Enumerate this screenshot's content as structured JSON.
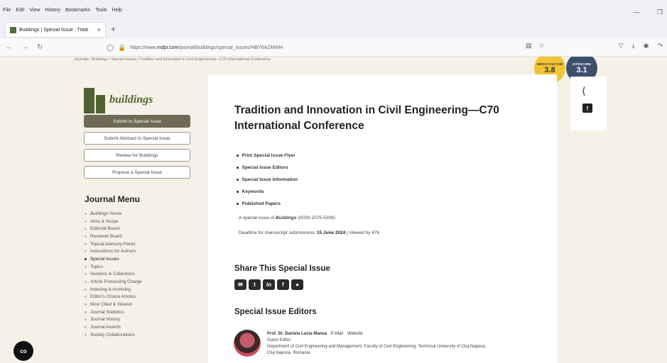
{
  "menubar": {
    "items": [
      "File",
      "Edit",
      "View",
      "History",
      "Bookmarks",
      "Tools",
      "Help"
    ]
  },
  "tab": {
    "title": "Buildings | Special Issue : Tradi",
    "close": "×",
    "new_tab": "+"
  },
  "navbar": {
    "url_prefix": "https://www.",
    "url_domain": "mdpi.com",
    "url_path": "/journal/buildings/special_issues/HBY6AZMWH"
  },
  "breadcrumb": "Journals / Buildings / Special Issues / Tradition and Innovation in Civil Engineering—C70 International Conference",
  "badges": {
    "impact_factor": {
      "label": "IMPACT FACTOR",
      "value": "3.8"
    },
    "citescore": {
      "label": "CITESCORE",
      "value": "3.1"
    }
  },
  "sidebar": {
    "journal_name": "buildings",
    "buttons": [
      "Submit to Special Issue",
      "Submit Abstract to Special Issue",
      "Review for Buildings",
      "Propose a Special Issue"
    ],
    "menu_title": "Journal Menu",
    "menu_home_italic": "Buildings",
    "menu_home_suffix": " Home",
    "menu_items": [
      "Aims & Scope",
      "Editorial Board",
      "Reviewer Board",
      "Topical Advisory Panel",
      "Instructions for Authors",
      "Special Issues",
      "Topics",
      "Sections & Collections",
      "Article Processing Charge",
      "Indexing & Archiving",
      "Editor's Choice Articles",
      "Most Cited & Viewed",
      "Journal Statistics",
      "Journal History",
      "Journal Awards",
      "Society Collaborations"
    ],
    "active_item": "Special Issues"
  },
  "main": {
    "title": "Tradition and Innovation in Civil Engineering—C70 International Conference",
    "toc": [
      "Print Special Issue Flyer",
      "Special Issue Editors",
      "Special Issue Information",
      "Keywords",
      "Published Papers"
    ],
    "desc_prefix": "A special issue of ",
    "desc_journal": "Buildings",
    "desc_suffix": " (ISSN 2075-5309).",
    "deadline_prefix": "Deadline for manuscript submissions: ",
    "deadline_date": "15 June 2024",
    "deadline_suffix": " | Viewed by 476",
    "share_heading": "Share This Special Issue",
    "share_icons": [
      "email-icon",
      "twitter-icon",
      "linkedin-icon",
      "facebook-icon",
      "wechat-icon"
    ],
    "editors_heading": "Special Issue Editors",
    "editor": {
      "name": "Prof. Dr. Daniela Lucia Manea",
      "email": "E-Mail",
      "website": "Website",
      "role": "Guest Editor",
      "affiliation_1": "Department of Civil Engineering and Management, Faculty of Civil Engineering, Technical University of Cluj-Napoca,",
      "affiliation_2": "Cluj-Napoca, Romania"
    }
  },
  "fab_label": "co"
}
